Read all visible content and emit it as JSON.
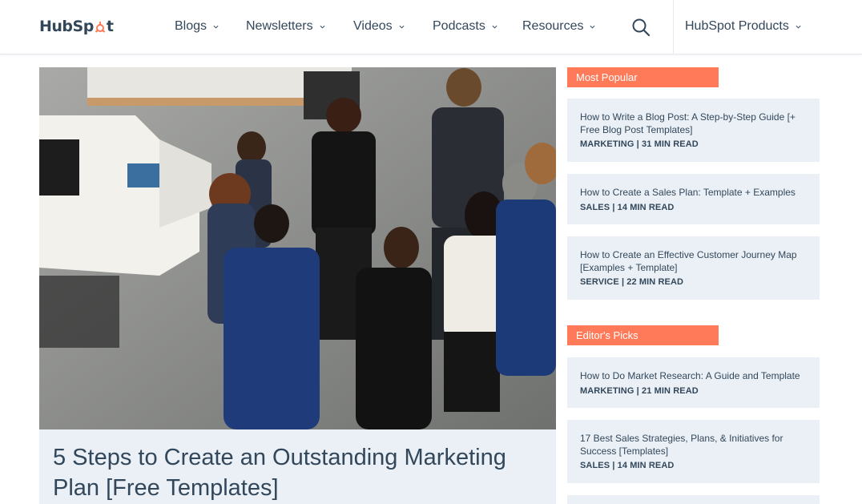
{
  "header": {
    "logo_text_left": "HubSp",
    "logo_text_right": "t",
    "nav": [
      {
        "label": "Blogs"
      },
      {
        "label": "Newsletters"
      },
      {
        "label": "Videos"
      },
      {
        "label": "Podcasts"
      },
      {
        "label": "Resources"
      }
    ],
    "products_label": "HubSpot Products",
    "icons": {
      "search": "search-icon",
      "chevron": "chevron-down-icon",
      "logo": "hubspot-sprocket-logo"
    }
  },
  "hero": {
    "title": "5 Steps to Create an Outstanding Marketing Plan [Free Templates]"
  },
  "sidebar": {
    "most_popular_label": "Most Popular",
    "most_popular": [
      {
        "title": "How to Write a Blog Post: A Step-by-Step Guide [+ Free Blog Post Templates]",
        "meta": "MARKETING | 31 MIN READ"
      },
      {
        "title": "How to Create a Sales Plan: Template + Examples",
        "meta": "SALES | 14 MIN READ"
      },
      {
        "title": "How to Create an Effective Customer Journey Map [Examples + Template]",
        "meta": "SERVICE | 22 MIN READ"
      }
    ],
    "editors_picks_label": "Editor's Picks",
    "editors_picks": [
      {
        "title": "How to Do Market Research: A Guide and Template",
        "meta": "MARKETING | 21 MIN READ"
      },
      {
        "title": "17 Best Sales Strategies, Plans, & Initiatives for Success [Templates]",
        "meta": "SALES | 14 MIN READ"
      }
    ]
  },
  "colors": {
    "accent": "#ff7a59",
    "text": "#33475b",
    "card_bg": "#eaf0f6"
  }
}
